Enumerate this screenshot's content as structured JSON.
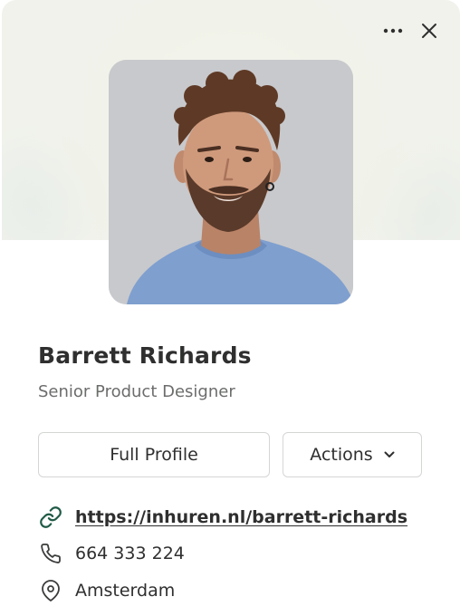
{
  "header": {
    "more_icon": "ellipsis-horizontal-icon",
    "close_icon": "close-icon"
  },
  "profile": {
    "name": "Barrett Richards",
    "title": "Senior Product Designer"
  },
  "buttons": {
    "full_profile": "Full Profile",
    "actions": "Actions"
  },
  "contact": {
    "link": "https://inhuren.nl/barrett-richards",
    "phone": "664 333 224",
    "location": "Amsterdam"
  },
  "colors": {
    "link": "#1f5a45",
    "text": "#2e2f2e",
    "muted": "#6b6d6b",
    "border": "#d4d6d4",
    "header_bg": "#f1f2ec"
  }
}
